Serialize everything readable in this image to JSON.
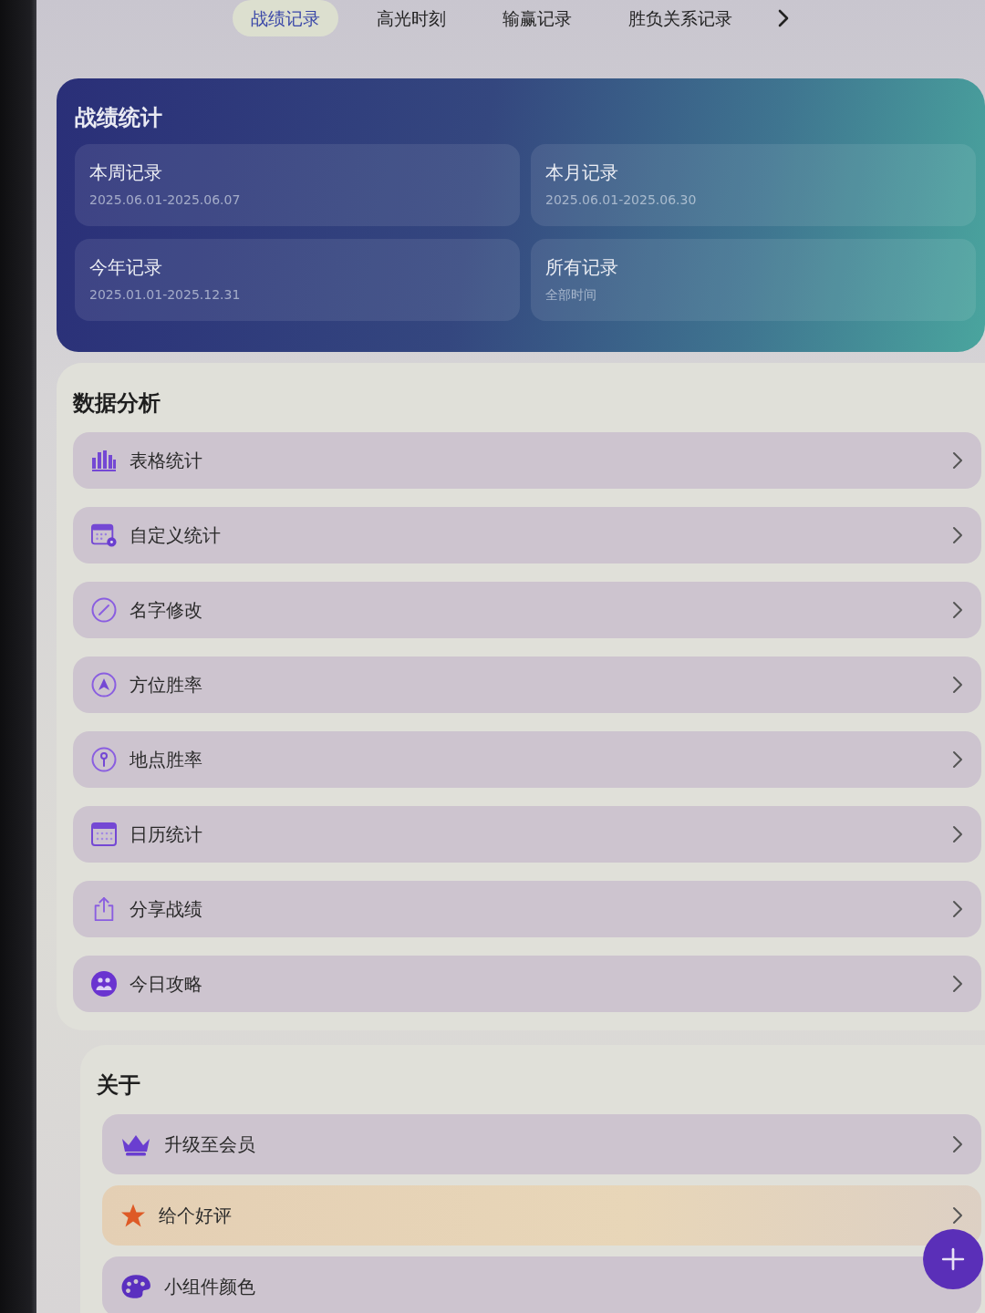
{
  "tabs": [
    {
      "label": "战绩记录",
      "selected": true
    },
    {
      "label": "高光时刻",
      "selected": false
    },
    {
      "label": "输赢记录",
      "selected": false
    },
    {
      "label": "胜负关系记录",
      "selected": false
    }
  ],
  "stats": {
    "title": "战绩统计",
    "tiles": [
      {
        "title": "本周记录",
        "range": "2025.06.01-2025.06.07"
      },
      {
        "title": "本月记录",
        "range": "2025.06.01-2025.06.30"
      },
      {
        "title": "今年记录",
        "range": "2025.01.01-2025.12.31"
      },
      {
        "title": "所有记录",
        "range": "全部时间"
      }
    ]
  },
  "analysis": {
    "title": "数据分析",
    "items": [
      "表格统计",
      "自定义统计",
      "名字修改",
      "方位胜率",
      "地点胜率",
      "日历统计",
      "分享战绩",
      "今日攻略"
    ]
  },
  "about": {
    "title": "关于",
    "items": [
      {
        "label": "升级至会员",
        "highlighted": false
      },
      {
        "label": "给个好评",
        "highlighted": true
      },
      {
        "label": "小组件颜色",
        "highlighted": false
      }
    ]
  }
}
